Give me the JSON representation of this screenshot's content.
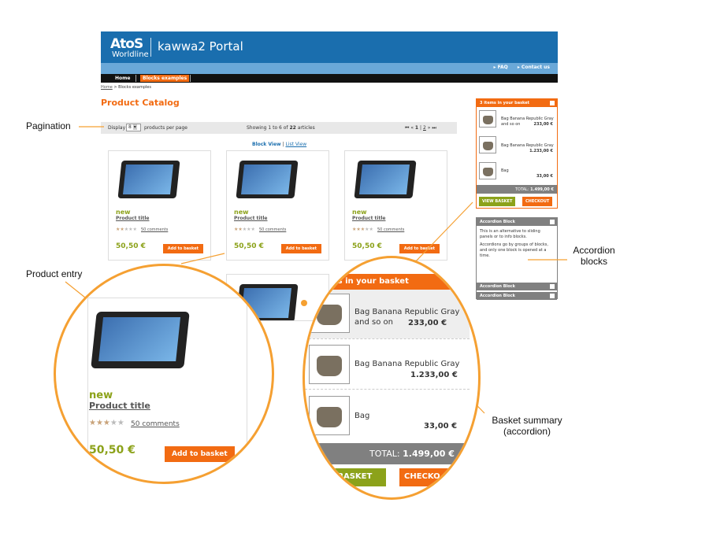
{
  "header": {
    "logo_main": "AtoS",
    "logo_sub": "Worldline",
    "portal": "kawwa2 Portal",
    "links": [
      "FAQ",
      "Contact us"
    ]
  },
  "nav": {
    "home": "Home",
    "blocks": "Blocks examples"
  },
  "breadcrumb": {
    "home": "Home",
    "sep": " > ",
    "current": "Blocks examples"
  },
  "page_title": "Product Catalog",
  "pagination": {
    "display": "Display",
    "per_page_value": "8",
    "per_page_label": "products per page",
    "showing": "Showing 1 to 6 of",
    "total": "22",
    "articles": "articles",
    "current_page": "1",
    "sep": "|",
    "next_page": "2"
  },
  "view_toggle": {
    "block": "Block View",
    "sep": "|",
    "list": "List View"
  },
  "product": {
    "badge": "new",
    "title": "Product title",
    "comments": "50 comments",
    "price": "50,50 €",
    "button": "Add to basket",
    "rating": 2.5
  },
  "basket": {
    "header": "3 items in your basket",
    "header_zoom": "tens in your basket",
    "items": [
      {
        "name": "Bag Banana Republic Gray",
        "name2": "and so on",
        "price": "233,00 €"
      },
      {
        "name": "Bag Banana Republic Gray",
        "name2": "",
        "price": "1.233,00 €"
      },
      {
        "name": "Bag",
        "name2": "",
        "price": "33,00 €"
      }
    ],
    "total_label": "TOTAL:",
    "total": "1.499,00 €",
    "view_basket": "VIEW BASKET",
    "view_basket_zoom": "EW BASKET",
    "checkout": "CHECKOUT",
    "checkout_zoom": "CHECKO"
  },
  "accordion": {
    "title": "Accordion Block",
    "text1": "This is an alternative to sliding panels or to info blocks.",
    "text2": "Accordions go by groups of blocks, and only one block is opened at a time.",
    "collapsed": [
      "Accordion Block",
      "Accordion Block"
    ]
  },
  "annotations": {
    "pagination": "Pagination",
    "product_entry": "Product entry",
    "accordion": [
      "Accordion",
      "blocks"
    ],
    "basket": [
      "Basket summary",
      "(accordion)"
    ]
  },
  "colors": {
    "orange": "#f26b12",
    "olive": "#8ca21a",
    "blue": "#1a6eae",
    "gray": "#808080"
  }
}
